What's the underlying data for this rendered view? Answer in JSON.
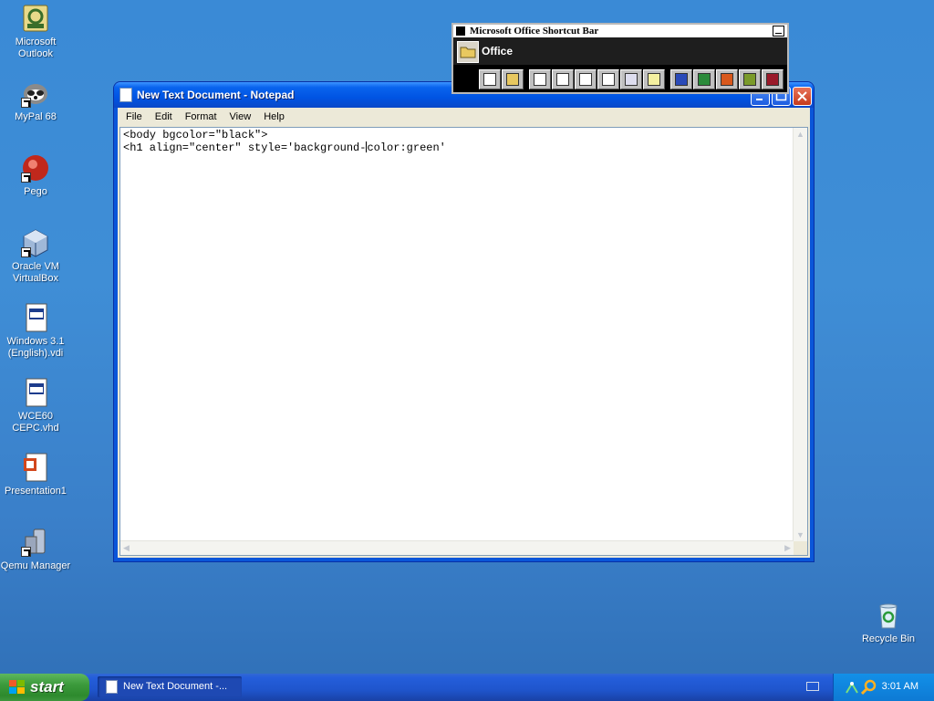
{
  "desktop": {
    "icons": [
      {
        "label": "Microsoft Outlook",
        "icon": "outlook-icon"
      },
      {
        "label": "MyPal 68",
        "icon": "mypal-icon"
      },
      {
        "label": "Pego",
        "icon": "pego-icon"
      },
      {
        "label": "Oracle VM VirtualBox",
        "icon": "virtualbox-icon"
      },
      {
        "label": "Windows 3.1 (English).vdi",
        "icon": "vdi-file-icon"
      },
      {
        "label": "WCE60 CEPC.vhd",
        "icon": "vhd-file-icon"
      },
      {
        "label": "Presentation1",
        "icon": "powerpoint-file-icon"
      },
      {
        "label": "Qemu Manager",
        "icon": "qemu-icon"
      },
      {
        "label": "Recycle Bin",
        "icon": "recycle-bin-icon"
      }
    ]
  },
  "notepad": {
    "title": "New Text Document - Notepad",
    "menu": [
      "File",
      "Edit",
      "Format",
      "View",
      "Help"
    ],
    "line1": "<body bgcolor=\"black\">",
    "line2_before_caret": "<h1 align=\"center\" style='background-",
    "line2_after_caret": "color:green'"
  },
  "office_bar": {
    "title": "Microsoft Office Shortcut Bar",
    "toolbar_label": "Office",
    "buttons": [
      "new-office-document",
      "open-office-document",
      "new-message",
      "new-appointment",
      "new-task",
      "new-contact",
      "new-journal-entry",
      "new-note",
      "word",
      "excel",
      "powerpoint",
      "publisher",
      "access"
    ]
  },
  "taskbar": {
    "start_label": "start",
    "task_notepad": "New Text Document -...",
    "clock": "3:01 AM"
  },
  "colors": {
    "desktop": "#3a8ad6",
    "titlebar": "#0054e3",
    "start_green": "#3c9a3c",
    "tray": "#0e7ad4"
  }
}
